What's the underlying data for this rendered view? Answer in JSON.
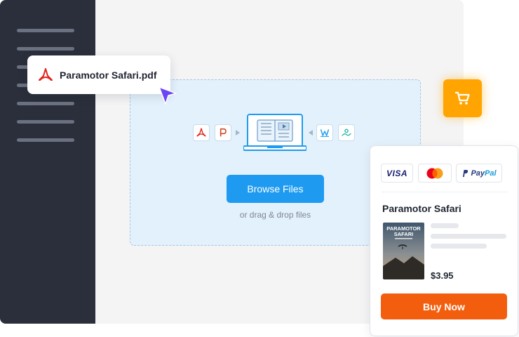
{
  "uploader": {
    "file_name": "Paramotor Safari.pdf",
    "browse_label": "Browse Files",
    "drag_hint": "or drag & drop files",
    "format_icons": [
      "pdf-icon",
      "powerpoint-icon",
      "word-icon",
      "image-icon"
    ]
  },
  "cart": {
    "icon": "shopping-cart-icon"
  },
  "checkout": {
    "payment_methods": [
      "VISA",
      "mastercard",
      "PayPal"
    ],
    "visa_label": "VISA",
    "paypal_pay": "Pay",
    "paypal_pal": "Pal",
    "product_title": "Paramotor Safari",
    "cover_title_line1": "PARAMOTOR",
    "cover_title_line2": "SAFARI",
    "price": "$3.95",
    "buy_label": "Buy Now"
  },
  "colors": {
    "sidebar": "#2a2f3b",
    "accent_blue": "#1e9bf0",
    "cart_orange": "#ffa400",
    "buy_orange": "#f25e0d",
    "pdf_red": "#e2231a",
    "cursor_purple": "#6a45f5"
  }
}
